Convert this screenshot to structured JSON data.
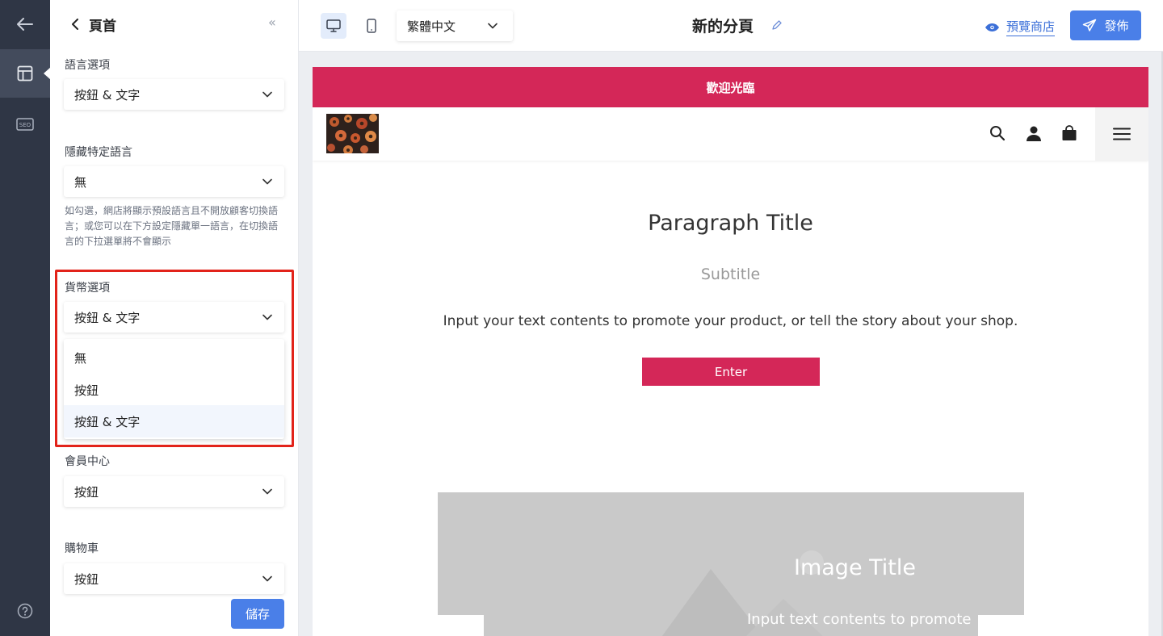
{
  "rail": {
    "back_icon": "arrow-left-icon",
    "layout_icon": "layout-icon",
    "seo_label": "SEO",
    "help_icon": "question-circle-icon"
  },
  "panel": {
    "title": "頁首",
    "language_option": {
      "label": "語言選項",
      "value": "按鈕 & 文字"
    },
    "hide_language": {
      "label": "隱藏特定語言",
      "value": "無",
      "hint": "如勾選，網店將顯示預設語言且不開放顧客切換語言；或您可以在下方設定隱藏單一語言，在切換語言的下拉選單將不會顯示"
    },
    "currency_option": {
      "label": "貨幣選項",
      "value": "按鈕 & 文字",
      "options": [
        "無",
        "按鈕",
        "按鈕 & 文字"
      ],
      "selected_index": 2
    },
    "member_center": {
      "label": "會員中心",
      "value": "按鈕"
    },
    "cart": {
      "label": "購物車",
      "value": "按鈕"
    },
    "save_label": "儲存"
  },
  "topbar": {
    "language_value": "繁體中文",
    "page_name": "新的分頁",
    "preview_label": "預覽商店",
    "publish_label": "發佈"
  },
  "site": {
    "announcement": "歡迎光臨",
    "paragraph_title": "Paragraph Title",
    "subtitle": "Subtitle",
    "body_text": "Input your text contents to promote your product, or tell the story about your shop.",
    "enter_label": "Enter",
    "banner_title": "Image Title",
    "banner_text": "Input text contents to promote"
  },
  "colors": {
    "accent_blue": "#4a7fe8",
    "brand_pink": "#d42758",
    "rail_bg": "#2f3645",
    "highlight_red": "#e2231a"
  }
}
